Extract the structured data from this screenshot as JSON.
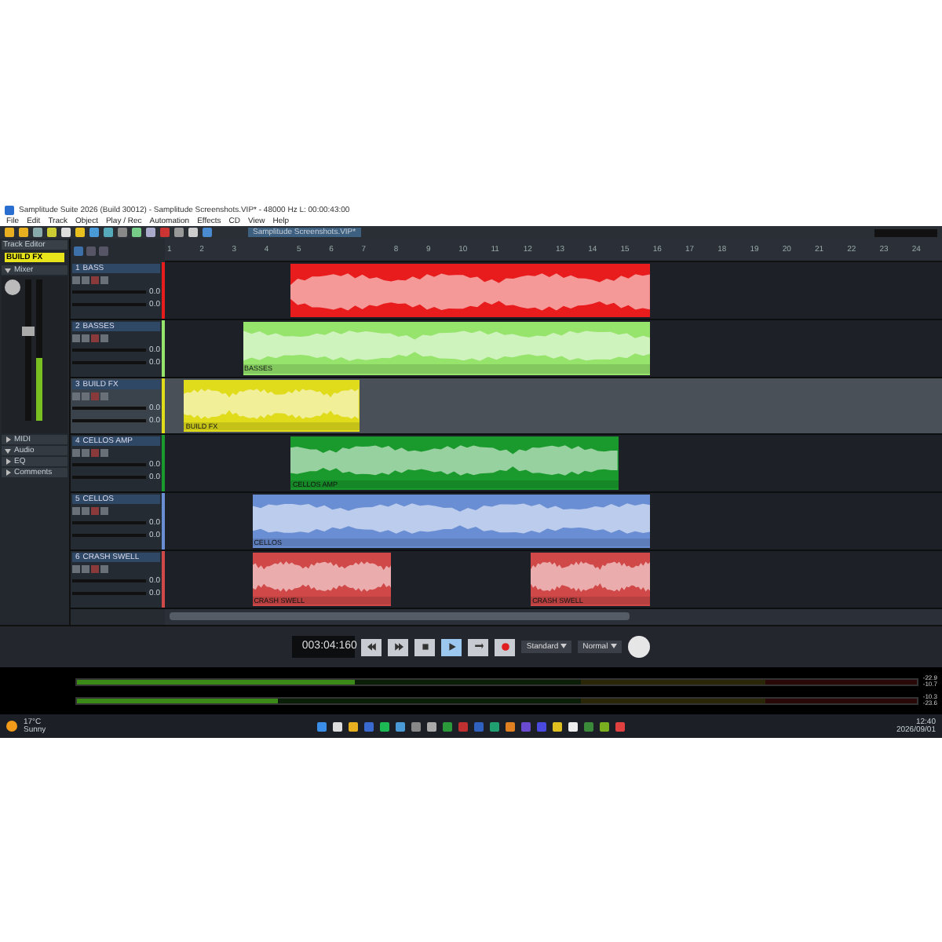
{
  "window": {
    "title": "Samplitude Suite 2026 (Build 30012) - Samplitude Screenshots.VIP* - 48000 Hz L: 00:00:43:00"
  },
  "menu": [
    "File",
    "Edit",
    "Track",
    "Object",
    "Play / Rec",
    "Automation",
    "Effects",
    "CD",
    "View",
    "Help"
  ],
  "project_tab": "Samplitude Screenshots.VIP*",
  "left_panel": {
    "title": "Track Editor",
    "track_name": "BUILD FX",
    "level": 0.45,
    "sections": [
      {
        "label": "Mixer",
        "expanded": true
      },
      {
        "label": "MIDI",
        "expanded": false
      },
      {
        "label": "Audio",
        "expanded": true
      },
      {
        "label": "EQ",
        "expanded": false
      },
      {
        "label": "Comments",
        "expanded": false
      }
    ]
  },
  "ruler": [
    "1",
    "2",
    "3",
    "4",
    "5",
    "6",
    "7",
    "8",
    "9",
    "10",
    "11",
    "12",
    "13",
    "14",
    "15",
    "16",
    "17",
    "18",
    "19",
    "20",
    "21",
    "22",
    "23",
    "24"
  ],
  "tracks": [
    {
      "number": "1",
      "name": "BASS",
      "color": "#e81c1c",
      "selected": false,
      "volume": "0.0",
      "pan": "0.0",
      "clips": [
        {
          "kind": "audio"
        }
      ]
    },
    {
      "number": "2",
      "name": "BASSES",
      "color": "#96e46c",
      "selected": false,
      "volume": "0.0",
      "pan": "0.0",
      "clips": [
        {
          "kind": "audio",
          "label": "BASSES"
        }
      ]
    },
    {
      "number": "3",
      "name": "BUILD FX",
      "color": "#e0dc1c",
      "selected": true,
      "volume": "0.0",
      "pan": "0.0",
      "clips": [
        {
          "kind": "audio",
          "label": "BUILD FX"
        }
      ]
    },
    {
      "number": "4",
      "name": "CELLOS AMP",
      "color": "#1a9a2c",
      "selected": false,
      "volume": "0.0",
      "pan": "0.0",
      "clips": [
        {
          "kind": "audio",
          "label": "CELLOS AMP"
        }
      ]
    },
    {
      "number": "5",
      "name": "CELLOS",
      "color": "#6a8ed4",
      "selected": false,
      "volume": "0.0",
      "pan": "0.0",
      "clips": [
        {
          "kind": "audio",
          "label": "CELLOS"
        }
      ]
    },
    {
      "number": "6",
      "name": "CRASH SWELL",
      "color": "#d04848",
      "selected": false,
      "volume": "0.0",
      "pan": "0.0",
      "clips": [
        {
          "kind": "audio",
          "label": "CRASH SWELL"
        },
        {
          "kind": "audio",
          "label": "CRASH SWELL"
        }
      ]
    }
  ],
  "transport": {
    "time": "003:04:160",
    "mode": "Standard",
    "sync": "Normal",
    "buttons": [
      {
        "kind": "rewind",
        "selected": false
      },
      {
        "kind": "forward",
        "selected": false
      },
      {
        "kind": "stop",
        "selected": false
      },
      {
        "kind": "play",
        "selected": true
      },
      {
        "kind": "loop",
        "selected": false
      },
      {
        "kind": "record",
        "selected": false
      }
    ]
  },
  "meters": [
    {
      "level": 0.33,
      "peak": "-22.9",
      "rms": "-10.7"
    },
    {
      "level": 0.24,
      "peak": "-10.3",
      "rms": "-23.6"
    }
  ],
  "taskbar": {
    "temperature": "17°C",
    "weather": "Sunny",
    "time": "12:40",
    "date": "2026/09/01"
  }
}
